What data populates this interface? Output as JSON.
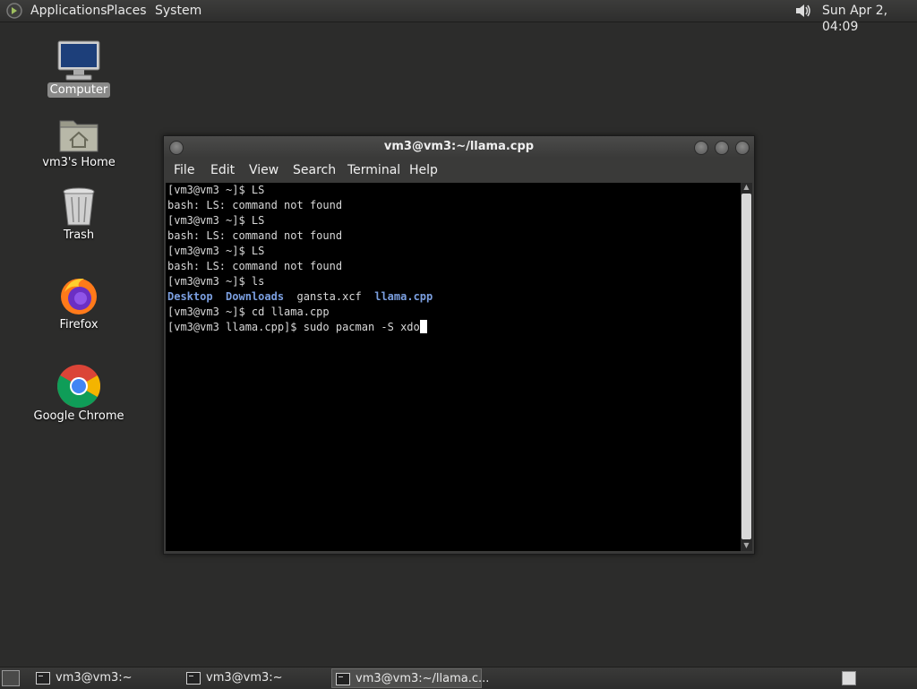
{
  "top_panel": {
    "menus": [
      "Applications",
      "Places",
      "System"
    ],
    "clock": "Sun Apr  2, 04:09",
    "icons": {
      "logo": "gnome-foot-icon",
      "volume": "volume-icon"
    }
  },
  "desktop": {
    "icons": [
      {
        "label": "Computer",
        "icon": "computer-icon"
      },
      {
        "label": "vm3's Home",
        "icon": "home-folder-icon"
      },
      {
        "label": "Trash",
        "icon": "trash-icon"
      },
      {
        "label": "Firefox",
        "icon": "firefox-icon"
      },
      {
        "label": "Google Chrome",
        "icon": "chrome-icon"
      }
    ]
  },
  "terminal": {
    "title": "vm3@vm3:~/llama.cpp",
    "menu": [
      "File",
      "Edit",
      "View",
      "Search",
      "Terminal",
      "Help"
    ],
    "lines": [
      "[vm3@vm3 ~]$ LS",
      "bash: LS: command not found",
      "[vm3@vm3 ~]$ LS",
      "bash: LS: command not found",
      "[vm3@vm3 ~]$ LS",
      "bash: LS: command not found",
      "[vm3@vm3 ~]$ ls",
      "",
      "[vm3@vm3 ~]$ cd llama.cpp",
      "[vm3@vm3 llama.cpp]$ sudo pacman -S xdo"
    ],
    "ls_output": [
      "Desktop",
      "Downloads",
      "gansta.xcf",
      "llama.cpp"
    ]
  },
  "taskbar": {
    "tasks": [
      "vm3@vm3:~",
      "vm3@vm3:~",
      "vm3@vm3:~/llama.c..."
    ]
  },
  "colors": {
    "desktop_bg": "#2c2c2b",
    "terminal_bg": "#000000",
    "directory_blue": "#7b9fe0"
  }
}
